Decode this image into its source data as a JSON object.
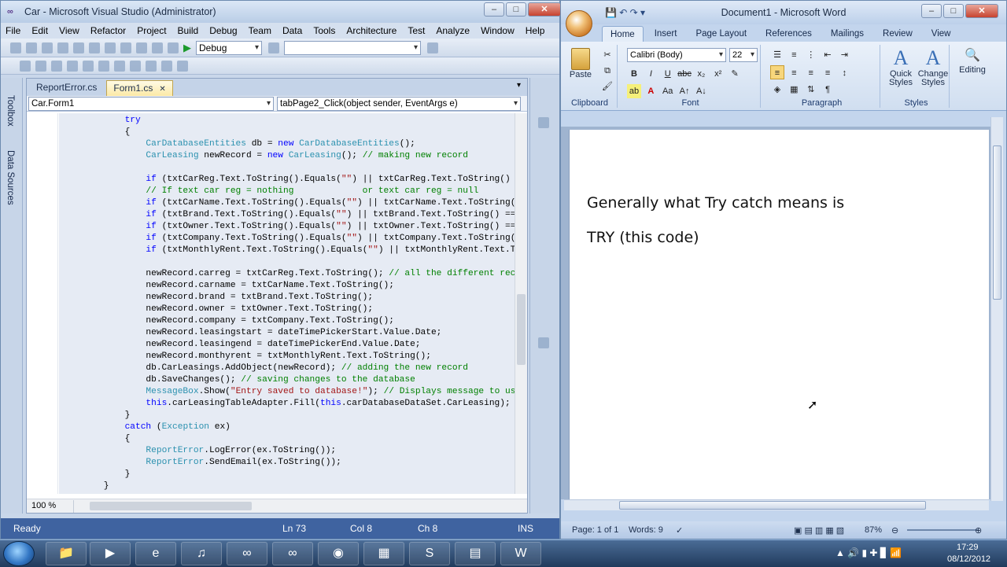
{
  "vs": {
    "title": "Car - Microsoft Visual Studio (Administrator)",
    "menu": [
      "File",
      "Edit",
      "View",
      "Refactor",
      "Project",
      "Build",
      "Debug",
      "Team",
      "Data",
      "Tools",
      "Architecture",
      "Test",
      "Analyze",
      "Window",
      "Help"
    ],
    "config_combo": "Debug",
    "side_tabs": [
      "Toolbox",
      "Data Sources"
    ],
    "doc_tabs": [
      "ReportError.cs",
      "Form1.cs"
    ],
    "nav_class": "Car.Form1",
    "nav_member": "tabPage2_Click(object sender, EventArgs e)",
    "zoom": "100 %",
    "status": {
      "ready": "Ready",
      "ln": "Ln 73",
      "col": "Col 8",
      "ch": "Ch 8",
      "ins": "INS"
    }
  },
  "word": {
    "title": "Document1 - Microsoft Word",
    "tabs": [
      "Home",
      "Insert",
      "Page Layout",
      "References",
      "Mailings",
      "Review",
      "View"
    ],
    "clipboard": {
      "paste": "Paste",
      "label": "Clipboard"
    },
    "font": {
      "name": "Calibri (Body)",
      "size": "22",
      "label": "Font"
    },
    "paragraph_label": "Paragraph",
    "styles": {
      "quick": "Quick Styles",
      "change": "Change Styles",
      "label": "Styles"
    },
    "editing": "Editing",
    "body_lines": [
      "Generally what Try catch means is",
      "TRY (this code)"
    ],
    "status": {
      "page": "Page: 1 of 1",
      "words": "Words: 9",
      "zoom": "87%"
    }
  },
  "taskbar": {
    "time": "17:29",
    "date": "08/12/2012"
  }
}
